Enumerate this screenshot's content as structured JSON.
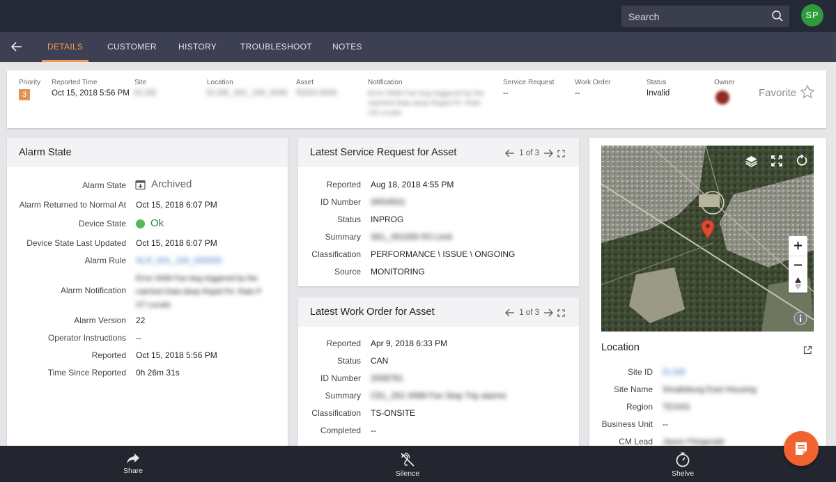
{
  "header": {
    "search_placeholder": "Search",
    "avatar_initials": "SP",
    "avatar_color": "#2e9a3a"
  },
  "tabs": [
    {
      "label": "DETAILS",
      "active": true
    },
    {
      "label": "CUSTOMER",
      "active": false
    },
    {
      "label": "HISTORY",
      "active": false
    },
    {
      "label": "TROUBLESHOOT",
      "active": false
    },
    {
      "label": "NOTES",
      "active": false
    }
  ],
  "summary": {
    "priority_label": "Priority",
    "priority_value": "3",
    "reported_time_label": "Reported Time",
    "reported_time_value": "Oct 15, 2018 5:56 PM",
    "site_label": "Site",
    "site_value": "ELSIE",
    "location_label": "Location",
    "location_value": "ELSIE_001_100_0005",
    "asset_label": "Asset",
    "asset_value": "R2D4-0005",
    "notification_label": "Notification",
    "notification_value_1": "Error 0068 Fan beg triggered by the",
    "notification_value_2": "catched Data deep Rapid Pe: Rate",
    "notification_value_3": "Lift Locate",
    "service_request_label": "Service Request",
    "service_request_value": "--",
    "work_order_label": "Work Order",
    "work_order_value": "--",
    "status_label": "Status",
    "status_value": "Invalid",
    "owner_label": "Owner",
    "favorite_label": "Favorite"
  },
  "alarm_state": {
    "title": "Alarm State",
    "rows": [
      {
        "label": "Alarm State",
        "value": "Archived"
      },
      {
        "label": "Alarm Returned to Normal At",
        "value": "Oct 15, 2018 6:07 PM"
      },
      {
        "label": "Device State",
        "value": "Ok"
      },
      {
        "label": "Device State Last Updated",
        "value": "Oct 15, 2018 6:07 PM"
      },
      {
        "label": "Alarm Rule",
        "value": "ALR_001_100_000005"
      },
      {
        "label": "Alarm Notification",
        "value_1": "Error 0068 Fan beg triggered by the",
        "value_2": "catched Data deep Rapid Pe: Rate P",
        "value_3": "ST Locate"
      },
      {
        "label": "Alarm Version",
        "value": "22"
      },
      {
        "label": "Operator Instructions",
        "value": "--"
      },
      {
        "label": "Reported",
        "value": "Oct 15, 2018 5:56 PM"
      },
      {
        "label": "Time Since Reported",
        "value": "0h 26m 31s"
      }
    ]
  },
  "service_request": {
    "title": "Latest Service Request for Asset",
    "pager": "1 of 3",
    "rows": [
      {
        "label": "Reported",
        "value": "Aug 18, 2018 4:55 PM"
      },
      {
        "label": "ID Number",
        "value": "SR04501"
      },
      {
        "label": "Status",
        "value": "INPROG"
      },
      {
        "label": "Summary",
        "value": "SEL_001000 R3 Limit"
      },
      {
        "label": "Classification",
        "value": "PERFORMANCE \\ ISSUE \\ ONGOING"
      },
      {
        "label": "Source",
        "value": "MONITORING"
      }
    ]
  },
  "work_order": {
    "title": "Latest Work Order for Asset",
    "pager": "1 of 3",
    "rows": [
      {
        "label": "Reported",
        "value": "Apr 9, 2018 6:33 PM"
      },
      {
        "label": "Status",
        "value": "CAN"
      },
      {
        "label": "ID Number",
        "value": "2008781"
      },
      {
        "label": "Summary",
        "value": "CEL_001 0068 Fan Stop Trip alarms"
      },
      {
        "label": "Classification",
        "value": "TS-ONSITE"
      },
      {
        "label": "Completed",
        "value": "--"
      }
    ]
  },
  "location": {
    "title": "Location",
    "rows": [
      {
        "label": "Site ID",
        "value": "ELSIE"
      },
      {
        "label": "Site Name",
        "value": "Smallsburg East Housing"
      },
      {
        "label": "Region",
        "value": "TEXAS"
      },
      {
        "label": "Business Unit",
        "value": "--"
      },
      {
        "label": "CM Lead",
        "value": "Jason Fitzgerald"
      }
    ]
  },
  "bottom_actions": {
    "share": "Share",
    "silence": "Silence",
    "shelve": "Shelve"
  },
  "colors": {
    "accent": "#f09a57",
    "topbar": "#252836",
    "tabbar": "#3d4053",
    "fab": "#f0622e",
    "ok": "#54b95f",
    "link": "#3f78c8"
  }
}
